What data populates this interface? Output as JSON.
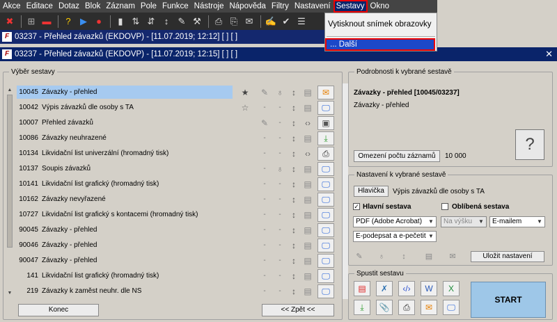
{
  "menubar": {
    "items": [
      "Akce",
      "Editace",
      "Dotaz",
      "Blok",
      "Záznam",
      "Pole",
      "Funkce",
      "Nástroje",
      "Nápověda",
      "Filtry",
      "Nastavení",
      "Sestavy",
      "Okno"
    ]
  },
  "dropdown": {
    "item1": "Vytisknout snímek obrazovky",
    "item2": "... Další"
  },
  "window1": {
    "title": "03237 - Přehled závazků (EKDOVP) - [11.07.2019; 12:12]  [ ]  [ ]"
  },
  "window2": {
    "title": "03237 - Přehled závazků (EKDOVP) - [11.07.2019; 12:15]  [ ]  [ ]"
  },
  "vyber": {
    "legend": "Výběr sestavy",
    "rows": [
      {
        "num": "10045",
        "name": "Závazky - přehled"
      },
      {
        "num": "10042",
        "name": "Výpis závazků dle osoby s TA"
      },
      {
        "num": "10007",
        "name": "Přehled závazků"
      },
      {
        "num": "10086",
        "name": "Závazky neuhrazené"
      },
      {
        "num": "10134",
        "name": "Likvidační list univerzální (hromadný tisk)"
      },
      {
        "num": "10137",
        "name": "Soupis závazků"
      },
      {
        "num": "10141",
        "name": "Likvidační list grafický (hromadný tisk)"
      },
      {
        "num": "10162",
        "name": "Závazky nevyřazené"
      },
      {
        "num": "10727",
        "name": "Likvidační list grafický s kontacemi (hromadný tisk)"
      },
      {
        "num": "90045",
        "name": "Závazky - přehled"
      },
      {
        "num": "90046",
        "name": "Závazky - přehled"
      },
      {
        "num": "90047",
        "name": "Závazky - přehled"
      },
      {
        "num": "141",
        "name": "Likvidační list grafický (hromadný tisk)"
      },
      {
        "num": "219",
        "name": "Závazky k zaměst neuhr. dle NS"
      }
    ],
    "konec": "Konec",
    "zpet": "<< Zpět <<"
  },
  "podrobnosti": {
    "legend": "Podrobnosti k vybrané sestavě",
    "title": "Závazky - přehled [10045/03237]",
    "subtitle": "Závazky - přehled",
    "omezeni_btn": "Omezení počtu záznamů",
    "omezeni_val": "10 000"
  },
  "nastaveni": {
    "legend": "Nastavení k vybrané sestavě",
    "hlavicka_btn": "Hlavička",
    "hlavicka_val": "Výpis závazků dle osoby s TA",
    "hlavni": "Hlavní sestava",
    "oblibena": "Oblíbená sestava",
    "format": "PDF (Adobe Acrobat)",
    "vysku": "Na výšku",
    "email": "E-mailem",
    "podpis": "E-podepsat a e-pečetit",
    "ulozit": "Uložit nastavení"
  },
  "spustit": {
    "legend": "Spustit sestavu",
    "start": "START"
  }
}
